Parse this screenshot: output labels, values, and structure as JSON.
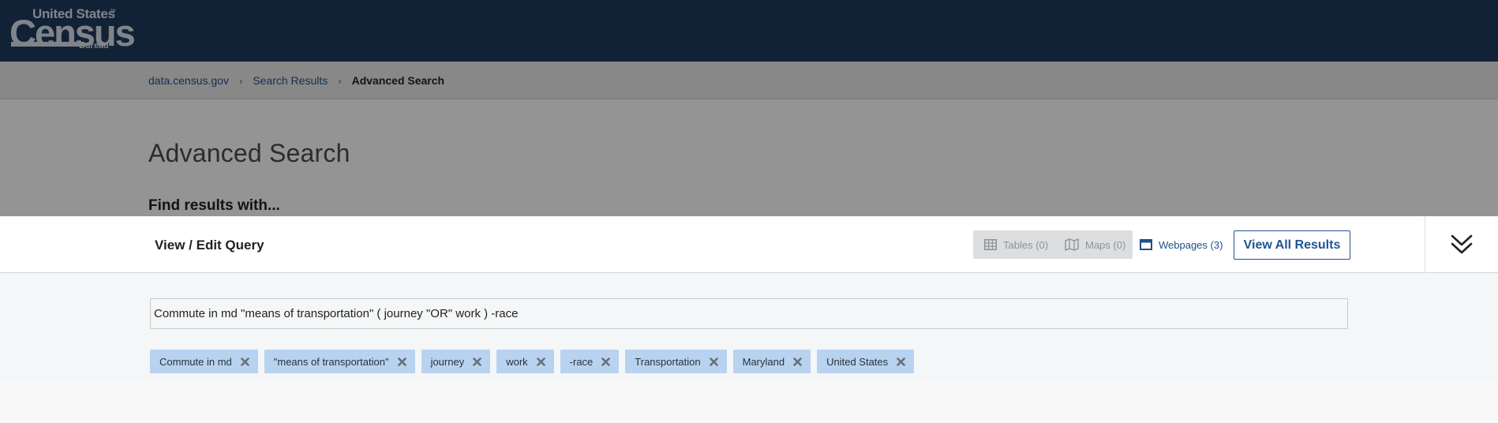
{
  "header": {
    "logo": {
      "line_top": "United States",
      "trademark": "™",
      "line_main": "Census",
      "line_bottom": "Bureau"
    }
  },
  "breadcrumb": {
    "items": [
      "data.census.gov",
      "Search Results",
      "Advanced Search"
    ],
    "separator": "›"
  },
  "page": {
    "title": "Advanced Search",
    "find_label": "Find results with..."
  },
  "query_panel": {
    "title": "View / Edit Query",
    "tabs": {
      "tables": "Tables (0)",
      "maps": "Maps (0)",
      "webpages": "Webpages (3)"
    },
    "view_all_label": "View All Results",
    "query_text": "Commute in md \"means of transportation\" ( journey \"OR\" work ) -race",
    "chips": [
      "Commute in md",
      "\"means of transportation\"",
      "journey",
      "work",
      "-race",
      "Transportation",
      "Maryland",
      "United States"
    ]
  },
  "icons": {
    "tables": "table-grid-icon",
    "maps": "map-icon",
    "webpages": "browser-window-icon",
    "collapse": "double-chevron-down-icon",
    "chip_remove": "close-x-icon"
  },
  "colors": {
    "header_bg": "#1f3b5e",
    "link": "#205493",
    "chip_bg": "#b7d3f0",
    "overlay": "rgba(0,0,0,0.42)"
  }
}
